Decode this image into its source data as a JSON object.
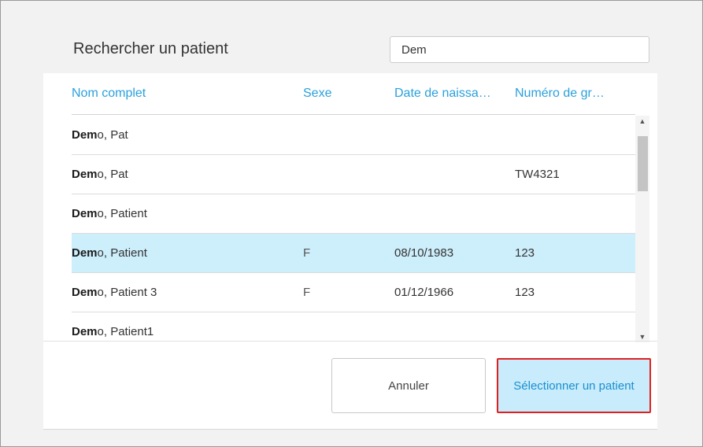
{
  "dialog": {
    "title": "Rechercher un patient",
    "search": {
      "value": "Dem",
      "placeholder": ""
    }
  },
  "columns": [
    "Nom complet",
    "Sexe",
    "Date de naissa…",
    "Numéro de gr…"
  ],
  "rows": [
    {
      "match": "Dem",
      "rest": "o, Pat",
      "sex": "",
      "dob": "",
      "num": "",
      "selected": false
    },
    {
      "match": "Dem",
      "rest": "o, Pat",
      "sex": "",
      "dob": "",
      "num": "TW4321",
      "selected": false
    },
    {
      "match": "Dem",
      "rest": "o, Patient",
      "sex": "",
      "dob": "",
      "num": "",
      "selected": false
    },
    {
      "match": "Dem",
      "rest": "o, Patient",
      "sex": "F",
      "dob": "08/10/1983",
      "num": "123",
      "selected": true
    },
    {
      "match": "Dem",
      "rest": "o, Patient 3",
      "sex": "F",
      "dob": "01/12/1966",
      "num": "123",
      "selected": false
    },
    {
      "match": "Dem",
      "rest": "o, Patient1",
      "sex": "",
      "dob": "",
      "num": "",
      "selected": false
    }
  ],
  "scrollbar": {
    "up_icon": "▲",
    "down_icon": "▼"
  },
  "buttons": {
    "cancel": "Annuler",
    "select": "Sélectionner un patient"
  },
  "colors": {
    "accent": "#2aa0dc",
    "selected_row": "#cdeefb",
    "highlight_border": "#e02020"
  }
}
